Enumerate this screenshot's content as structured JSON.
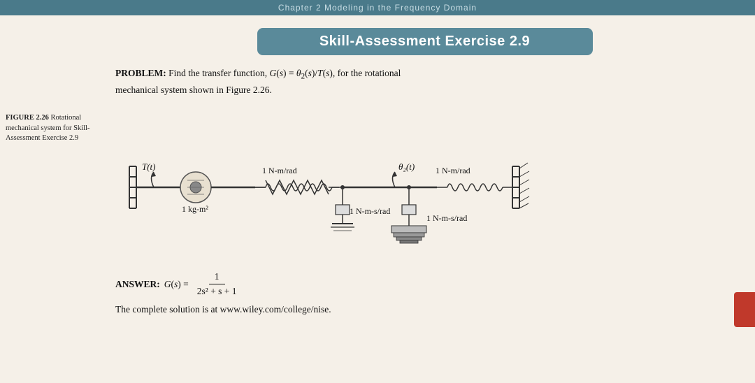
{
  "topbar": {
    "text": "Chapter 2        Modeling in the Frequency Domain"
  },
  "title": "Skill-Assessment Exercise 2.9",
  "problem": {
    "label": "PROBLEM:",
    "text": " Find the transfer function, G(s) = θ₂(s)/T(s), for the rotational mechanical system shown in Figure 2.26."
  },
  "figure_caption": {
    "label": "FIGURE 2.26",
    "text": " Rotational mechanical system for Skill-Assessment Exercise 2.9"
  },
  "diagram": {
    "labels": {
      "T_t": "T(t)",
      "spring1": "1 N-m/rad",
      "spring2": "1 N-m/rad",
      "inertia": "1 kg-m²",
      "damper_mid": "1 N-m-s/rad",
      "damper_bot": "1 N-m-s/rad",
      "theta2": "θ₂(t)"
    }
  },
  "answer": {
    "label": "ANSWER:",
    "gs_label": "G(s) =",
    "numerator": "1",
    "denominator": "2s² + s + 1"
  },
  "website": {
    "text": "The complete solution is at www.wiley.com/college/nise."
  }
}
